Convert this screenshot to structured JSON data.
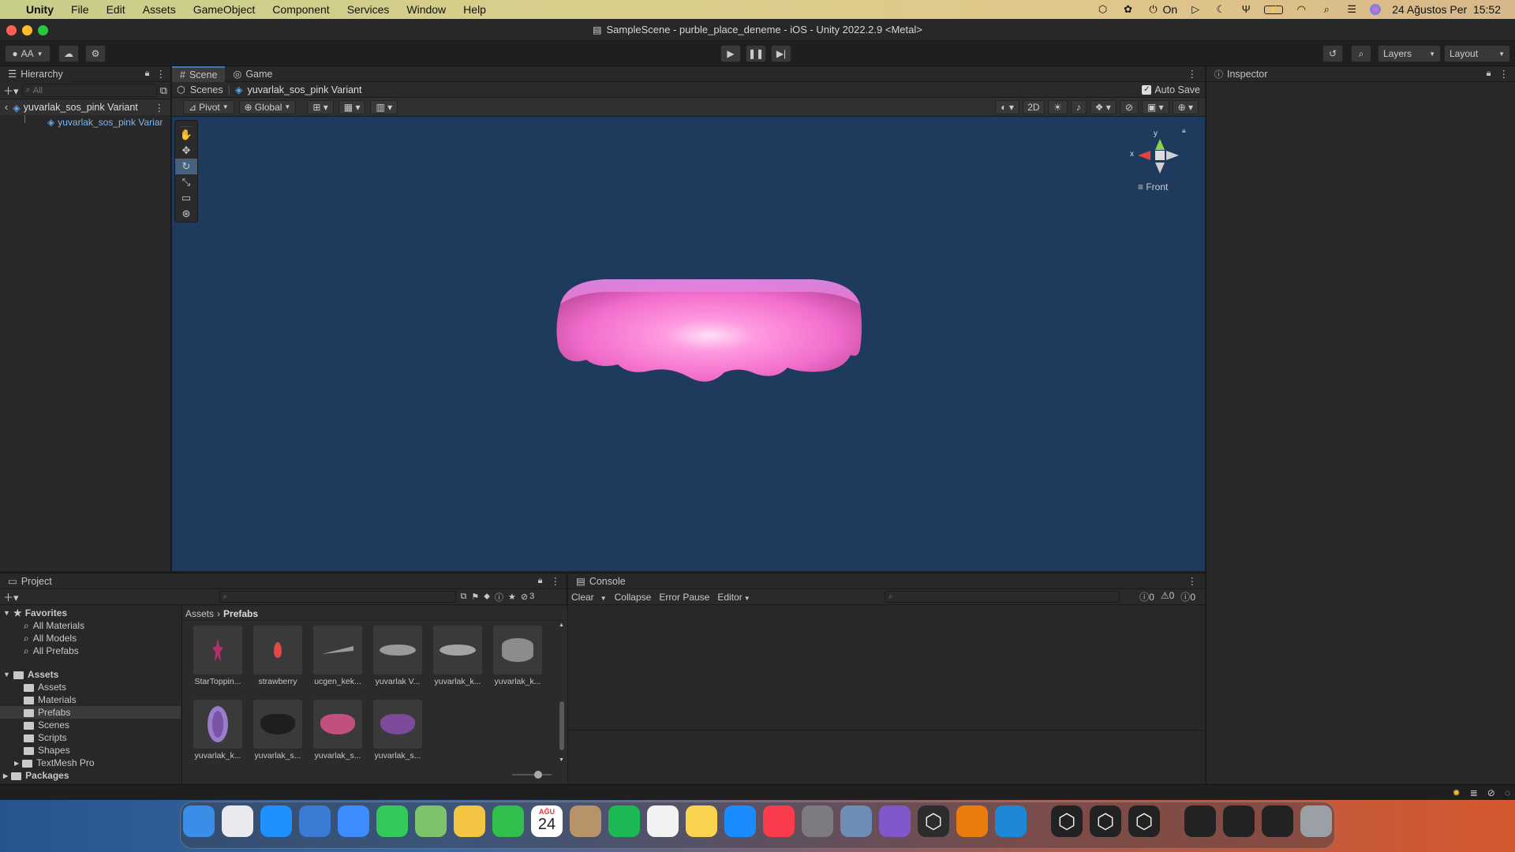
{
  "mac_menu": {
    "app": "Unity",
    "items": [
      "File",
      "Edit",
      "Assets",
      "GameObject",
      "Component",
      "Services",
      "Window",
      "Help"
    ],
    "status_on": "On",
    "datetime": "24 Ağustos Per  15:52"
  },
  "window": {
    "title": "SampleScene - purble_place_deneme - iOS - Unity 2022.2.9 <Metal>"
  },
  "toolbar": {
    "account": "AA",
    "layers": "Layers",
    "layout": "Layout"
  },
  "hierarchy": {
    "tab": "Hierarchy",
    "search_placeholder": "All",
    "root": "yuvarlak_sos_pink Variant",
    "child": "yuvarlak_sos_pink Variar"
  },
  "scene": {
    "tabs": [
      "Scene",
      "Game"
    ],
    "breadcrumb_root": "Scenes",
    "breadcrumb_item": "yuvarlak_sos_pink Variant",
    "auto_save": "Auto Save",
    "pivot": "Pivot",
    "global": "Global",
    "mode_2d": "2D",
    "gizmo_view": "Front",
    "gizmo_x": "x",
    "gizmo_y": "y"
  },
  "inspector": {
    "tab": "Inspector"
  },
  "project": {
    "tab": "Project",
    "hidden_count": "3",
    "favorites": {
      "label": "Favorites",
      "items": [
        "All Materials",
        "All Models",
        "All Prefabs"
      ]
    },
    "assets": {
      "label": "Assets",
      "items": [
        "Assets",
        "Materials",
        "Prefabs",
        "Scenes",
        "Scripts",
        "Shapes",
        "TextMesh Pro"
      ]
    },
    "packages": "Packages",
    "breadcrumb": [
      "Assets",
      "Prefabs"
    ],
    "grid": [
      {
        "name": "StarToppin...",
        "thumb": "star-topping",
        "color": "#b0306f"
      },
      {
        "name": "strawberry",
        "thumb": "strawberry",
        "color": "#e04b48"
      },
      {
        "name": "ucgen_kek...",
        "thumb": "triangle-cake",
        "color": "#9a9a9a"
      },
      {
        "name": "yuvarlak V...",
        "thumb": "round-disc",
        "color": "#9a9a9a"
      },
      {
        "name": "yuvarlak_k...",
        "thumb": "round-disc",
        "color": "#a3a3a3"
      },
      {
        "name": "yuvarlak_k...",
        "thumb": "round-cylinder",
        "color": "#8c8c8c"
      },
      {
        "name": "yuvarlak_k...",
        "thumb": "purple-ring",
        "color": "#7a52a6"
      },
      {
        "name": "yuvarlak_s...",
        "thumb": "black-sauce",
        "color": "#1e1e1e"
      },
      {
        "name": "yuvarlak_s...",
        "thumb": "pink-sauce",
        "color": "#c2507f"
      },
      {
        "name": "yuvarlak_s...",
        "thumb": "purple-sauce",
        "color": "#7d4a9a"
      }
    ]
  },
  "console": {
    "tab": "Console",
    "clear": "Clear",
    "collapse": "Collapse",
    "error_pause": "Error Pause",
    "editor": "Editor",
    "log_count": "0",
    "warn_count": "0",
    "error_count": "0"
  },
  "dock": {
    "calendar_month": "AĞU",
    "calendar_day": "24",
    "apps": [
      "finder-icon",
      "launchpad-icon",
      "safari-icon",
      "xcode-icon",
      "mail-icon",
      "messages-icon",
      "maps-icon",
      "photos-icon",
      "facetime-icon",
      "calendar-icon",
      "contacts-icon",
      "spotify-icon",
      "reminders-icon",
      "notes-icon",
      "app-store-icon",
      "music-icon",
      "system-settings-icon",
      "preview-icon",
      "visual-studio-icon",
      "unity-hub-icon",
      "blender-icon",
      "vscode-icon",
      "unity-icon",
      "unity-icon",
      "unity-icon",
      "screenshot-icon",
      "screenshot-icon",
      "screenshot-icon",
      "trash-icon"
    ]
  },
  "colors": {
    "accent": "#3a79bb",
    "scene_bg": "#1e3a5c",
    "sauce_pink": "#f47bd0"
  }
}
